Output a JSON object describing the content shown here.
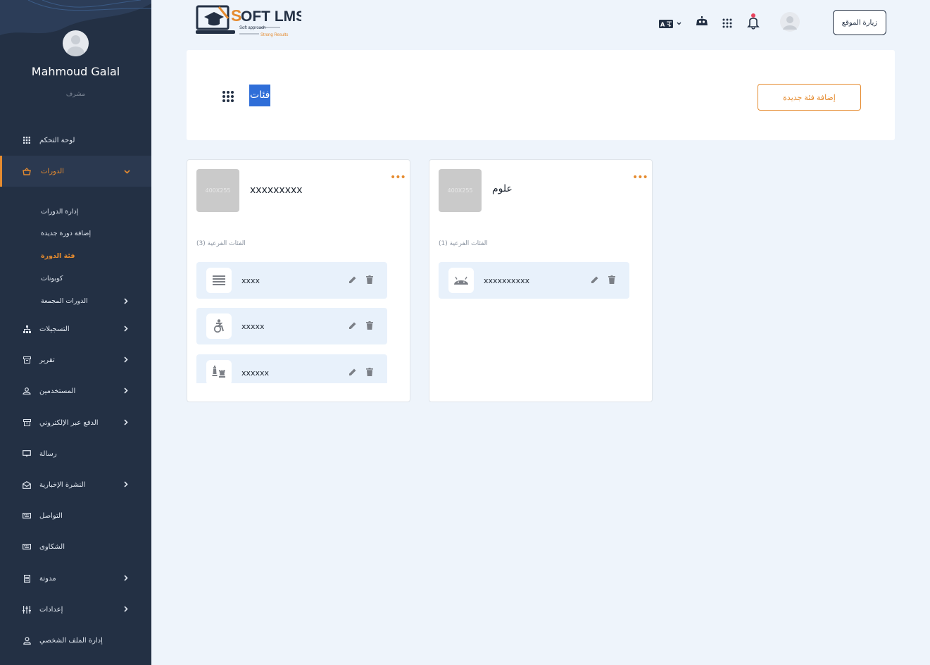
{
  "user": {
    "name": "Mahmoud Galal",
    "role": "مشرف"
  },
  "sidebar": {
    "items": [
      {
        "label": "لوحة التحكم",
        "icon": "dashboard-grid-icon"
      },
      {
        "label": "الدورات",
        "icon": "courses-basket-icon"
      },
      {
        "label": "التسجيلات",
        "icon": "registrations-hierarchy-icon"
      },
      {
        "label": "تقرير",
        "icon": "report-archive-icon"
      },
      {
        "label": "المستخدمين",
        "icon": "users-icon"
      },
      {
        "label": "الدفع عبر الإلكتروني",
        "icon": "payment-archive-icon"
      },
      {
        "label": "رسالة",
        "icon": "message-icon"
      },
      {
        "label": "النشرة الإخبارية",
        "icon": "newsletter-envelope-icon"
      },
      {
        "label": "التواصل",
        "icon": "contact-keyboard-icon"
      },
      {
        "label": "الشكاوى",
        "icon": "complaints-keyboard-icon"
      },
      {
        "label": "مدونة",
        "icon": "blog-document-icon"
      },
      {
        "label": "إعدادات",
        "icon": "settings-sliders-icon"
      },
      {
        "label": "إدارة الملف الشخصي",
        "icon": "profile-user-icon"
      }
    ],
    "subitems": [
      {
        "label": "إدارة الدورات"
      },
      {
        "label": "إضافة دورة جديدة"
      },
      {
        "label": "فئة الدورة"
      },
      {
        "label": "كوبونات"
      },
      {
        "label": "الدورات المجمعة"
      }
    ]
  },
  "header": {
    "logo_text": "SOFT LMS",
    "logo_tagline_1": "Soft approach",
    "logo_tagline_2": "Strong Results",
    "visit_site_label": "زيارة الموقع"
  },
  "page": {
    "title": "فئات",
    "add_button_label": "إضافة فئة جديدة"
  },
  "categories": [
    {
      "name": "xxxxxxxxx",
      "thumb": "400X255",
      "sub_count_label": "الفئات الفرعية (3)",
      "subs": [
        {
          "name": "xxxx",
          "icon": "list-lines-icon"
        },
        {
          "name": "xxxxx",
          "icon": "accessibility-icon"
        },
        {
          "name": "xxxxxx",
          "icon": "chess-icon"
        }
      ]
    },
    {
      "name": "علوم",
      "thumb": "400X255",
      "sub_count_label": "الفئات الفرعية (1)",
      "subs": [
        {
          "name": "xxxxxxxxxx",
          "icon": "android-icon"
        }
      ]
    }
  ],
  "colors": {
    "accent": "#e58b2f",
    "sidebar": "#233044",
    "title_highlight": "#2f6ed8"
  }
}
